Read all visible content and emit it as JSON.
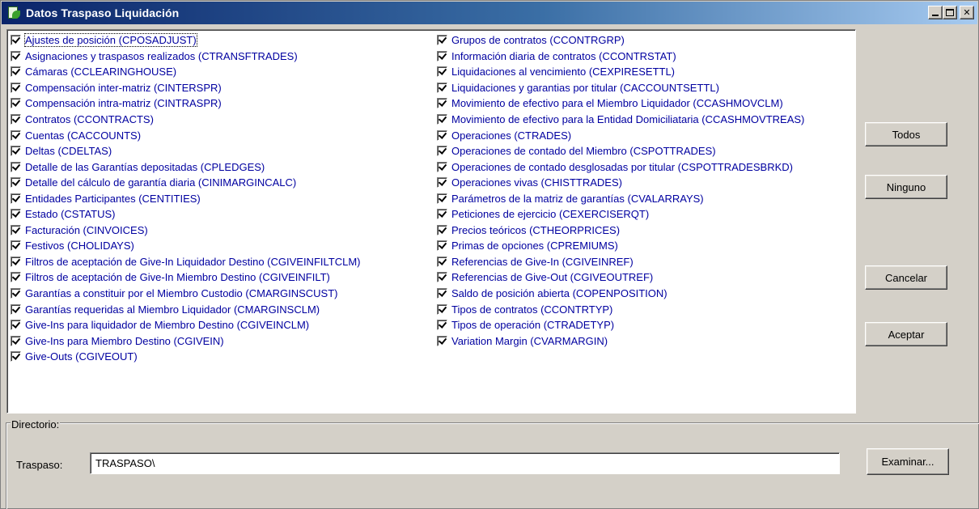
{
  "window": {
    "title": "Datos Traspaso Liquidación",
    "icon": "app-document-icon",
    "controls": {
      "minimize_icon": "minimize-icon",
      "maximize_icon": "maximize-icon",
      "close_glyph": "✕"
    }
  },
  "tables": {
    "left": [
      {
        "label": "Ajustes de posición (CPOSADJUST)",
        "checked": true
      },
      {
        "label": "Asignaciones y traspasos realizados (CTRANSFTRADES)",
        "checked": true
      },
      {
        "label": "Cámaras (CCLEARINGHOUSE)",
        "checked": true
      },
      {
        "label": "Compensación inter-matriz (CINTERSPR)",
        "checked": true
      },
      {
        "label": "Compensación intra-matriz (CINTRASPR)",
        "checked": true
      },
      {
        "label": "Contratos (CCONTRACTS)",
        "checked": true
      },
      {
        "label": "Cuentas (CACCOUNTS)",
        "checked": true
      },
      {
        "label": "Deltas (CDELTAS)",
        "checked": true
      },
      {
        "label": "Detalle de las Garantías depositadas (CPLEDGES)",
        "checked": true
      },
      {
        "label": "Detalle del cálculo de garantía diaria (CINIMARGINCALC)",
        "checked": true
      },
      {
        "label": "Entidades Participantes (CENTITIES)",
        "checked": true
      },
      {
        "label": "Estado (CSTATUS)",
        "checked": true
      },
      {
        "label": "Facturación (CINVOICES)",
        "checked": true
      },
      {
        "label": "Festivos (CHOLIDAYS)",
        "checked": true
      },
      {
        "label": "Filtros de aceptación de Give-In Liquidador Destino (CGIVEINFILTCLM)",
        "checked": true
      },
      {
        "label": "Filtros de aceptación de Give-In Miembro Destino (CGIVEINFILT)",
        "checked": true
      },
      {
        "label": "Garantías a constituir por el Miembro Custodio (CMARGINSCUST)",
        "checked": true
      },
      {
        "label": "Garantías requeridas al Miembro Liquidador (CMARGINSCLM)",
        "checked": true
      },
      {
        "label": "Give-Ins para liquidador de Miembro Destino (CGIVEINCLM)",
        "checked": true
      },
      {
        "label": "Give-Ins para Miembro Destino (CGIVEIN)",
        "checked": true
      },
      {
        "label": "Give-Outs (CGIVEOUT)",
        "checked": true
      }
    ],
    "right": [
      {
        "label": "Grupos de contratos (CCONTRGRP)",
        "checked": true
      },
      {
        "label": "Información diaria de contratos (CCONTRSTAT)",
        "checked": true
      },
      {
        "label": "Liquidaciones al vencimiento (CEXPIRESETTL)",
        "checked": true
      },
      {
        "label": "Liquidaciones y garantias por titular (CACCOUNTSETTL)",
        "checked": true
      },
      {
        "label": "Movimiento de efectivo para el Miembro Liquidador (CCASHMOVCLM)",
        "checked": true
      },
      {
        "label": "Movimiento de efectivo para la Entidad Domiciliataria (CCASHMOVTREAS)",
        "checked": true
      },
      {
        "label": "Operaciones (CTRADES)",
        "checked": true
      },
      {
        "label": "Operaciones de contado del Miembro (CSPOTTRADES)",
        "checked": true
      },
      {
        "label": "Operaciones de contado desglosadas por titular (CSPOTTRADESBRKD)",
        "checked": true
      },
      {
        "label": "Operaciones vivas (CHISTTRADES)",
        "checked": true
      },
      {
        "label": "Parámetros de la matriz de garantías (CVALARRAYS)",
        "checked": true
      },
      {
        "label": "Peticiones de ejercicio (CEXERCISERQT)",
        "checked": true
      },
      {
        "label": "Precios teóricos (CTHEORPRICES)",
        "checked": true
      },
      {
        "label": "Primas de opciones (CPREMIUMS)",
        "checked": true
      },
      {
        "label": "Referencias de Give-In (CGIVEINREF)",
        "checked": true
      },
      {
        "label": "Referencias de Give-Out (CGIVEOUTREF)",
        "checked": true
      },
      {
        "label": "Saldo de posición abierta (COPENPOSITION)",
        "checked": true
      },
      {
        "label": "Tipos de contratos (CCONTRTYP)",
        "checked": true
      },
      {
        "label": "Tipos de operación (CTRADETYP)",
        "checked": true
      },
      {
        "label": "Variation Margin (CVARMARGIN)",
        "checked": true
      }
    ]
  },
  "buttons": {
    "todos": "Todos",
    "ninguno": "Ninguno",
    "cancelar": "Cancelar",
    "aceptar": "Aceptar",
    "examinar": "Examinar..."
  },
  "directory": {
    "legend": "Directorio:",
    "traspaso_label": "Traspaso:",
    "traspaso_value": "TRASPASO\\"
  },
  "colors": {
    "title_gradient_start": "#0a246a",
    "title_gradient_end": "#a6caf0",
    "item_text": "#0000a0",
    "face": "#d4d0c8"
  }
}
